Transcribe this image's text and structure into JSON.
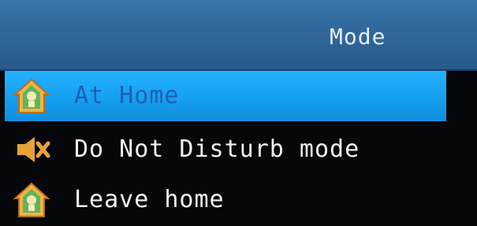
{
  "header": {
    "title": "Mode"
  },
  "menu": {
    "items": [
      {
        "label": "At Home",
        "icon": "house-icon",
        "selected": true
      },
      {
        "label": "Do Not Disturb mode",
        "icon": "speaker-mute-icon",
        "selected": false
      },
      {
        "label": "Leave home",
        "icon": "house-icon",
        "selected": false
      }
    ]
  },
  "colors": {
    "header_bg": "#2f6599",
    "selected_bg": "#139eee",
    "selected_text": "#1f5fb0",
    "text": "#f2f2f2",
    "icon_orange": "#e7a23a"
  }
}
